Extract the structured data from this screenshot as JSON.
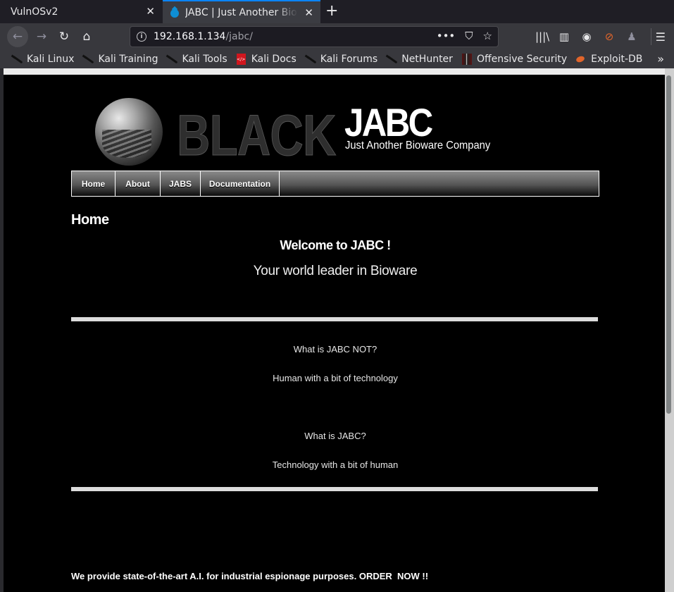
{
  "browser": {
    "tabs": [
      {
        "label": "VulnOSv2",
        "active": false,
        "close_icon": "close-icon"
      },
      {
        "label": "JABC | Just Another Bioware Company",
        "active": true,
        "favicon": "drupal-drop-icon",
        "close_icon": "close-icon"
      }
    ],
    "new_tab_symbol": "+",
    "nav": {
      "back_symbol": "←",
      "forward_symbol": "→",
      "reload_symbol": "↻",
      "home_symbol": "⌂"
    },
    "url": {
      "host": "192.168.1.134",
      "path": "/jabc/",
      "info_symbol": "i"
    },
    "url_actions": {
      "more_symbol": "•••",
      "pocket_symbol": "⛉",
      "bookmark_symbol": "☆"
    },
    "toolbar_icons": [
      {
        "name": "library-icon",
        "symbol": "|||\\"
      },
      {
        "name": "sidebar-icon",
        "symbol": "▥"
      },
      {
        "name": "account-icon",
        "symbol": "◉"
      },
      {
        "name": "extension-blocked-icon",
        "symbol": "⊘"
      },
      {
        "name": "extension-icon",
        "symbol": "♟"
      }
    ],
    "menu_symbol": "☰",
    "bookmarks": [
      {
        "label": "Kali Linux",
        "icon": "kali-dragon-icon"
      },
      {
        "label": "Kali Training",
        "icon": "kali-dragon-icon"
      },
      {
        "label": "Kali Tools",
        "icon": "kali-dragon-icon"
      },
      {
        "label": "Kali Docs",
        "icon": "kali-docs-icon"
      },
      {
        "label": "Kali Forums",
        "icon": "kali-dragon-icon"
      },
      {
        "label": "NetHunter",
        "icon": "kali-dragon-icon"
      },
      {
        "label": "Offensive Security",
        "icon": "offsec-icon"
      },
      {
        "label": "Exploit-DB",
        "icon": "exploit-db-icon"
      }
    ],
    "bookmarks_more_symbol": "»"
  },
  "site": {
    "logo_text": "BLACK",
    "title": "JABC",
    "slogan": "Just Another Bioware Company",
    "menu": [
      {
        "label": "Home"
      },
      {
        "label": "About"
      },
      {
        "label": "JABS"
      },
      {
        "label": "Documentation"
      }
    ],
    "page_heading": "Home",
    "welcome": "Welcome to JABC !",
    "tagline": "Your world leader in Bioware",
    "qa": [
      {
        "question": "What is JABC NOT?",
        "answer": "Human with a bit of technology"
      },
      {
        "question": "What is JABC?",
        "answer": "Technology with a bit of human"
      }
    ],
    "footer_text": "We provide state-of-the-art A.I. for industrial espionage purposes. ORDER  NOW !!"
  }
}
